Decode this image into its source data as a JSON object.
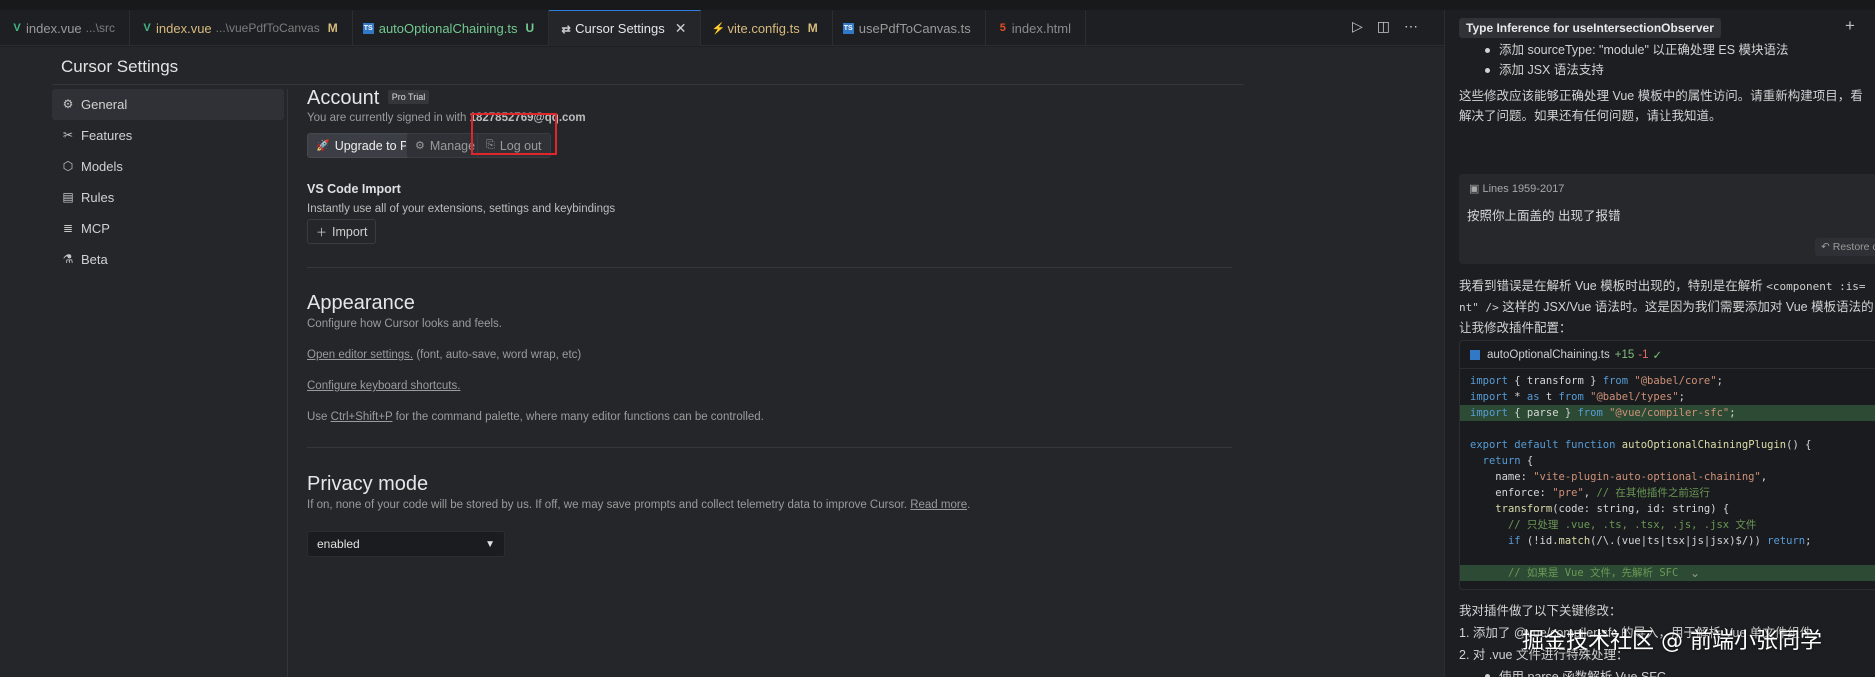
{
  "tabs": [
    {
      "name": "index.vue",
      "sub": "...\\src",
      "flag": "",
      "icon": "vue-icon",
      "icon_color": "#41b883",
      "active": false,
      "name_color": "#9a9a9a"
    },
    {
      "name": "index.vue",
      "sub": "...\\vuePdfToCanvas",
      "flag": "M",
      "icon": "vue-icon",
      "icon_color": "#41b883",
      "active": false,
      "name_color": "#d7ba7d"
    },
    {
      "name": "autoOptionalChaining.ts",
      "sub": "",
      "flag": "U",
      "icon": "ts-icon",
      "icon_color": "#3178c6",
      "active": false,
      "name_color": "#73c991"
    },
    {
      "name": "Cursor Settings",
      "sub": "",
      "flag": "",
      "icon": "settings-icon",
      "icon_color": "#cccccc",
      "active": true,
      "name_color": "#e6e6e6"
    },
    {
      "name": "vite.config.ts",
      "sub": "",
      "flag": "M",
      "icon": "vite-icon",
      "icon_color": "#f7c42a",
      "active": false,
      "name_color": "#d7ba7d"
    },
    {
      "name": "usePdfToCanvas.ts",
      "sub": "",
      "flag": "",
      "icon": "ts-icon",
      "icon_color": "#3178c6",
      "active": false,
      "name_color": "#9a9a9a"
    },
    {
      "name": "index.html",
      "sub": "",
      "flag": "",
      "icon": "html-icon",
      "icon_color": "#e44d26",
      "active": false,
      "name_color": "#8a8a8a"
    }
  ],
  "settings": {
    "title": "Cursor Settings",
    "nav": [
      {
        "label": "General",
        "icon": "gear-icon",
        "active": true
      },
      {
        "label": "Features",
        "icon": "tools-icon",
        "active": false
      },
      {
        "label": "Models",
        "icon": "cube-icon",
        "active": false
      },
      {
        "label": "Rules",
        "icon": "book-icon",
        "active": false
      },
      {
        "label": "MCP",
        "icon": "server-icon",
        "active": false
      },
      {
        "label": "Beta",
        "icon": "flask-icon",
        "active": false
      }
    ],
    "account": {
      "heading": "Account",
      "badge": "Pro Trial",
      "signed_in_prefix": "You are currently signed in with",
      "email": "1827852769@qq.com",
      "upgrade_label": "Upgrade to Pro",
      "manage_label": "Manage",
      "logout_label": "Log out"
    },
    "vscode_import": {
      "heading": "VS Code Import",
      "description": "Instantly use all of your extensions, settings and keybindings",
      "import_label": "Import"
    },
    "appearance": {
      "heading": "Appearance",
      "description": "Configure how Cursor looks and feels.",
      "editor_settings_link": "Open editor settings.",
      "editor_settings_suffix": "(font, auto-save, word wrap, etc)",
      "keyboard_link": "Configure keyboard shortcuts.",
      "palette_prefix": "Use",
      "palette_shortcut": "Ctrl+Shift+P",
      "palette_suffix": "for the command palette, where many editor functions can be controlled."
    },
    "privacy": {
      "heading": "Privacy mode",
      "description": "If on, none of your code will be stored by us. If off, we may save prompts and collect telemetry data to improve Cursor.",
      "read_more": "Read more",
      "selected": "enabled"
    }
  },
  "chat": {
    "tab_title": "Type Inference for useIntersectionObserver",
    "bullets": [
      "添加 sourceType: \"module\" 以正确处理 ES 模块语法",
      "添加 JSX 语法支持"
    ],
    "para1_line1": "这些修改应该能够正确处理 Vue 模板中的属性访问。请重新构建项目，看",
    "para1_line2": "解决了问题。如果还有任何问题，请让我知道。",
    "lines_label": "Lines 1959-2017",
    "user_message": "按照你上面盖的 出现了报错",
    "restore_label": "Restore c",
    "para2_line1a": "我看到错误是在解析 Vue 模板时出现的，特别是在解析",
    "para2_line1b": "<component :is=",
    "para2_line2a": "nt\" />",
    "para2_line2b": "这样的 JSX/Vue 语法时。这是因为我们需要添加对 Vue 模板语法的",
    "para2_line3": "让我修改插件配置：",
    "code_file": "autoOptionalChaining.ts",
    "code_added": "+15",
    "code_removed": "-1",
    "code_lines": [
      "import { transform } from \"@babel/core\";",
      "import * as t from \"@babel/types\";",
      "import { parse } from \"@vue/compiler-sfc\";",
      "",
      "export default function autoOptionalChainingPlugin() {",
      "  return {",
      "    name: \"vite-plugin-auto-optional-chaining\",",
      "    enforce: \"pre\", // 在其他插件之前运行",
      "    transform(code: string, id: string) {",
      "      // 只处理 .vue, .ts, .tsx, .js, .jsx 文件",
      "      if (!id.match(/\\.(vue|ts|tsx|js|jsx)$/)) return;",
      "",
      "      // 如果是 Vue 文件，先解析 SFC"
    ],
    "summary": "我对插件做了以下关键修改：",
    "list1": "1. 添加了 @vue/compiler-sfc 的导入，用于解析 Vue 单文件组件",
    "list2": "2. 对 .vue 文件进行特殊处理：",
    "list3": "使用 parse 函数解析 Vue SFC"
  },
  "watermark": "掘金技术社区 @ 前端小张同学"
}
